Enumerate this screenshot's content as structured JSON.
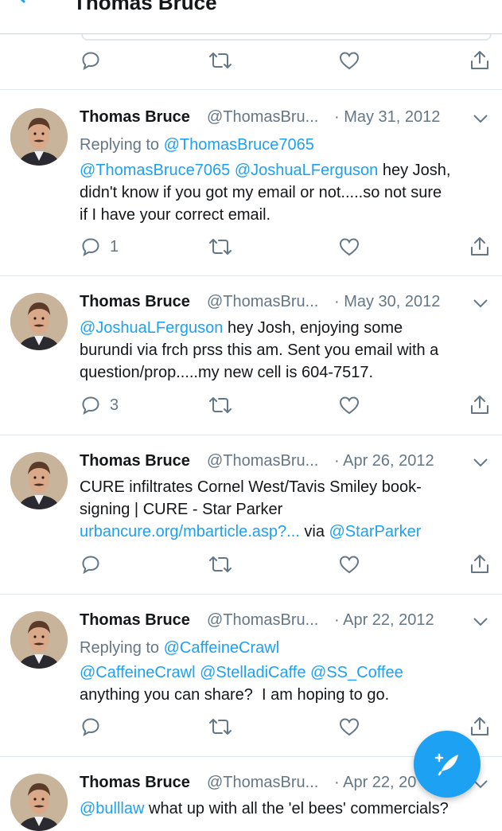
{
  "header": {
    "title": "Thomas Bruce"
  },
  "colors": {
    "accent": "#1da1f2",
    "text": "#14171a",
    "muted": "#657786"
  },
  "icons": {
    "back": "back-arrow-icon",
    "reply": "reply-icon",
    "retweet": "retweet-icon",
    "like": "like-icon",
    "share": "share-icon",
    "more": "chevron-down-icon",
    "compose": "compose-tweet-icon"
  },
  "tweets": [
    {
      "name": "Thomas Bruce",
      "handle": "@ThomasBru...",
      "date": "· May 31, 2012",
      "reply_prefix": "Replying to ",
      "reply_to": "@ThomasBruce7065",
      "mention1": "@ThomasBruce7065",
      "mention2": "@JoshuaLFerguson",
      "text_tail": " hey Josh,",
      "line2": "didn't know if you got my email or not.....so not sure",
      "line3": "if I have your correct email.",
      "reply_count": "1"
    },
    {
      "name": "Thomas Bruce",
      "handle": "@ThomasBru...",
      "date": "· May 30, 2012",
      "mention1": "@JoshuaLFerguson",
      "text_tail": " hey Josh, enjoying some",
      "line2": "burundi via frch prss this am. Sent you email with a",
      "line3": "question/prop.....my new cell is 604-7517.",
      "reply_count": "3"
    },
    {
      "name": "Thomas Bruce",
      "handle": "@ThomasBru...",
      "date": "· Apr 26, 2012",
      "line1": "CURE infiltrates Cornel West/Tavis Smiley book-",
      "line2": "signing | CURE - Star Parker",
      "link": "urbancure.org/mbarticle.asp?...",
      "via": " via ",
      "mention1": "@StarParker"
    },
    {
      "name": "Thomas Bruce",
      "handle": "@ThomasBru...",
      "date": "· Apr 22, 2012",
      "reply_prefix": "Replying to ",
      "reply_to": "@CaffeineCrawl",
      "mention1": "@CaffeineCrawl",
      "mention2": "@StelladiCaffe",
      "mention3": "@SS_Coffee",
      "line3": "anything you can share?  I am hoping to go."
    },
    {
      "name": "Thomas Bruce",
      "handle": "@ThomasBru...",
      "date": "· Apr 22, 20",
      "mention1": "@bulllaw",
      "text_tail": " what up with all the 'el bees' commercials?"
    }
  ]
}
